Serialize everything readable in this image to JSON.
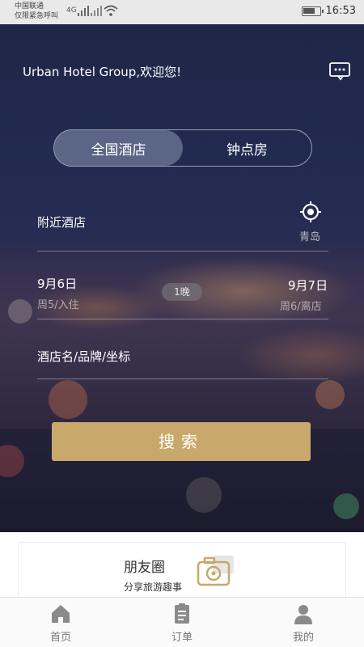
{
  "status": {
    "carrier_line1": "中国联通",
    "carrier_line2": "仅限紧急呼叫",
    "network": "4G",
    "time": "16:53"
  },
  "hero": {
    "welcome": "Urban Hotel Group,欢迎您!",
    "tabs": [
      {
        "label": "全国酒店",
        "active": true
      },
      {
        "label": "钟点房",
        "active": false
      }
    ],
    "location": {
      "label": "附近酒店",
      "city": "青岛"
    },
    "checkin": {
      "date": "9月6日",
      "sub": "周5/入住"
    },
    "checkout": {
      "date": "9月7日",
      "sub": "周6/离店"
    },
    "nights": "1晚",
    "keyword_placeholder": "酒店名/品牌/坐标",
    "search_label": "搜索",
    "accent": "#c8a86b"
  },
  "card": {
    "title": "朋友圈",
    "subtitle": "分享旅游趣事",
    "icon": "camera-icon"
  },
  "bottom_nav": [
    {
      "label": "首页",
      "icon": "home-icon"
    },
    {
      "label": "订单",
      "icon": "clipboard-icon"
    },
    {
      "label": "我的",
      "icon": "user-icon"
    }
  ]
}
